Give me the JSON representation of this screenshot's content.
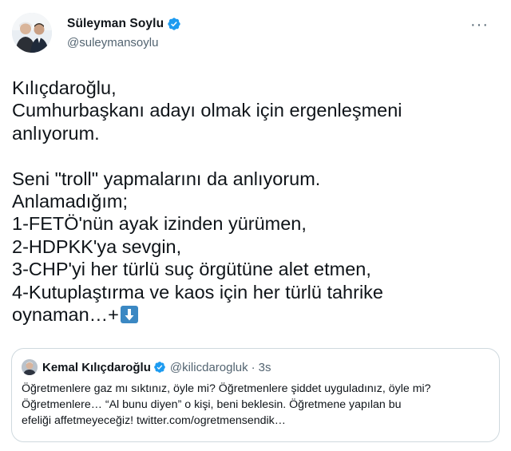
{
  "tweet": {
    "display_name": "Süleyman Soylu",
    "handle": "@suleymansoylu",
    "more_label": "···",
    "body_lines": [
      "Kılıçdaroğlu,",
      "Cumhurbaşkanı adayı olmak için ergenleşmeni",
      "anlıyorum.",
      "",
      "Seni \"troll\" yapmalarını da anlıyorum.",
      "Anlamadığım;",
      "1-FETÖ'nün ayak izinden yürümen,",
      "2-HDPKK'ya sevgin,",
      "3-CHP'yi her türlü suç örgütüne alet etmen,",
      "4-Kutuplaştırma ve kaos için her türlü tahrike",
      "oynaman…+"
    ],
    "trailing_emoji": "down-arrow-emoji"
  },
  "quote": {
    "display_name": "Kemal Kılıçdaroğlu",
    "handle": "@kilicdarogluk",
    "separator": "·",
    "time": "3s",
    "text_lines": [
      "Öğretmenlere gaz mı sıktınız, öyle mi? Öğretmenlere şiddet uyguladınız, öyle mi?",
      "Öğretmenlere… “Al bunu diyen” o kişi, beni beklesin. Öğretmene yapılan bu",
      "efeliği affetmeyeceğiz! twitter.com/ogretmensendik…"
    ]
  },
  "colors": {
    "text": "#0f1419",
    "secondary": "#536471",
    "verified": "#1d9bf0",
    "border": "#cfd9de",
    "emoji_blue": "#3b88c3"
  }
}
